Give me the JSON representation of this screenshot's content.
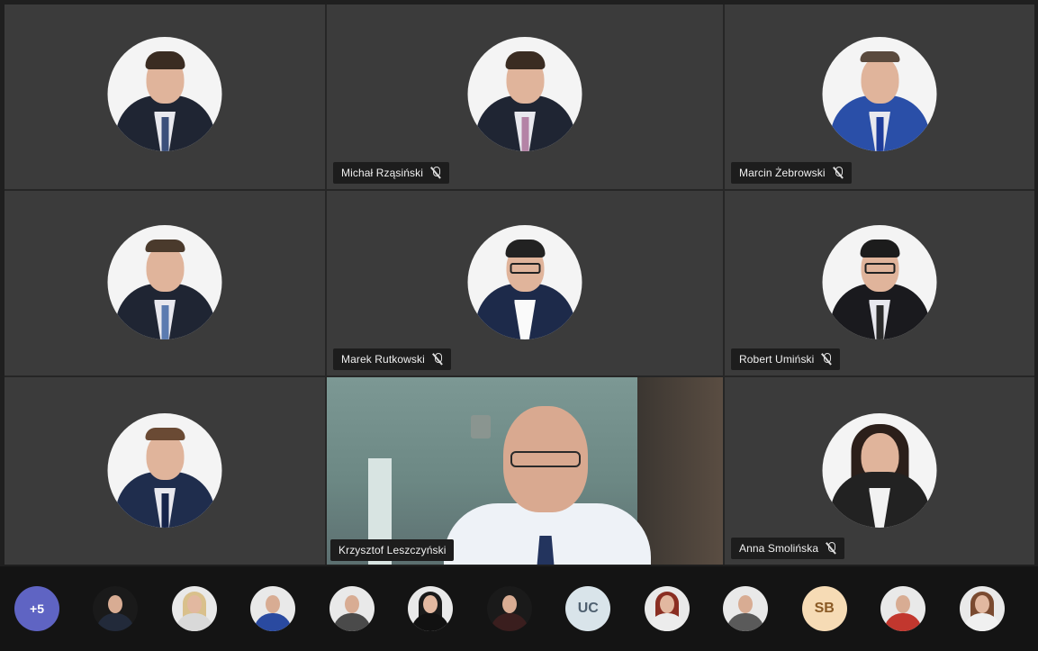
{
  "meeting": {
    "tiles": [
      {
        "name": "",
        "avatar": "man-suit-tie"
      },
      {
        "name": "Michał Rząsiński",
        "avatar": "man-suit-pink-tie",
        "muted": true
      },
      {
        "name": "Marcin Żebrowski",
        "avatar": "man-blue-suit",
        "muted": true
      },
      {
        "name": "",
        "avatar": "man-smiling"
      },
      {
        "name": "Marek Rutkowski",
        "avatar": "man-glasses",
        "muted": true
      },
      {
        "name": "Robert Umiński",
        "avatar": "man-glasses-suit",
        "muted": true
      },
      {
        "name": "",
        "avatar": "man-suit-tie"
      },
      {
        "name": "Krzysztof Leszczyński",
        "video": true,
        "muted": false
      },
      {
        "name": "Anna Smolińska",
        "avatar": "woman-dark-hair",
        "muted": true
      }
    ],
    "muted_icon": "mic-off-icon"
  },
  "strip": {
    "overflow_label": "+5",
    "participants": [
      {
        "type": "photo",
        "avatar": "man-dark"
      },
      {
        "type": "photo",
        "avatar": "woman-blonde"
      },
      {
        "type": "photo",
        "avatar": "man-suit"
      },
      {
        "type": "photo",
        "avatar": "man-grey-suit"
      },
      {
        "type": "photo",
        "avatar": "woman-dark"
      },
      {
        "type": "photo",
        "avatar": "man-dark-small"
      },
      {
        "type": "initials",
        "initials": "UC"
      },
      {
        "type": "photo",
        "avatar": "woman-red-hair"
      },
      {
        "type": "photo",
        "avatar": "man-older"
      },
      {
        "type": "initials",
        "initials": "SB"
      },
      {
        "type": "photo",
        "avatar": "man-red-shirt"
      },
      {
        "type": "photo",
        "avatar": "woman-brown-hair"
      }
    ]
  },
  "colors": {
    "tile_bg": "#3b3b3b",
    "strip_bg": "#141414",
    "overflow_badge": "#5f64c3"
  }
}
